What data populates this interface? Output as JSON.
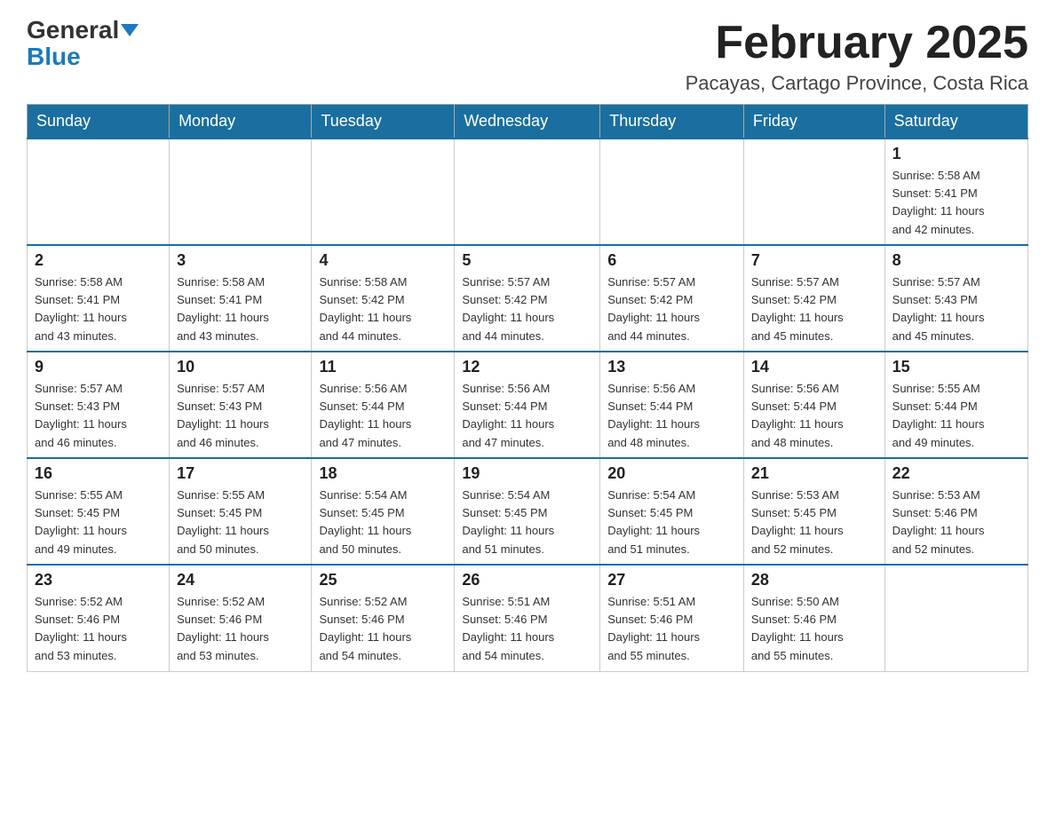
{
  "header": {
    "logo_line1": "General",
    "logo_line2": "Blue",
    "month_title": "February 2025",
    "location": "Pacayas, Cartago Province, Costa Rica"
  },
  "weekdays": [
    "Sunday",
    "Monday",
    "Tuesday",
    "Wednesday",
    "Thursday",
    "Friday",
    "Saturday"
  ],
  "weeks": [
    [
      {
        "day": "",
        "info": ""
      },
      {
        "day": "",
        "info": ""
      },
      {
        "day": "",
        "info": ""
      },
      {
        "day": "",
        "info": ""
      },
      {
        "day": "",
        "info": ""
      },
      {
        "day": "",
        "info": ""
      },
      {
        "day": "1",
        "info": "Sunrise: 5:58 AM\nSunset: 5:41 PM\nDaylight: 11 hours\nand 42 minutes."
      }
    ],
    [
      {
        "day": "2",
        "info": "Sunrise: 5:58 AM\nSunset: 5:41 PM\nDaylight: 11 hours\nand 43 minutes."
      },
      {
        "day": "3",
        "info": "Sunrise: 5:58 AM\nSunset: 5:41 PM\nDaylight: 11 hours\nand 43 minutes."
      },
      {
        "day": "4",
        "info": "Sunrise: 5:58 AM\nSunset: 5:42 PM\nDaylight: 11 hours\nand 44 minutes."
      },
      {
        "day": "5",
        "info": "Sunrise: 5:57 AM\nSunset: 5:42 PM\nDaylight: 11 hours\nand 44 minutes."
      },
      {
        "day": "6",
        "info": "Sunrise: 5:57 AM\nSunset: 5:42 PM\nDaylight: 11 hours\nand 44 minutes."
      },
      {
        "day": "7",
        "info": "Sunrise: 5:57 AM\nSunset: 5:42 PM\nDaylight: 11 hours\nand 45 minutes."
      },
      {
        "day": "8",
        "info": "Sunrise: 5:57 AM\nSunset: 5:43 PM\nDaylight: 11 hours\nand 45 minutes."
      }
    ],
    [
      {
        "day": "9",
        "info": "Sunrise: 5:57 AM\nSunset: 5:43 PM\nDaylight: 11 hours\nand 46 minutes."
      },
      {
        "day": "10",
        "info": "Sunrise: 5:57 AM\nSunset: 5:43 PM\nDaylight: 11 hours\nand 46 minutes."
      },
      {
        "day": "11",
        "info": "Sunrise: 5:56 AM\nSunset: 5:44 PM\nDaylight: 11 hours\nand 47 minutes."
      },
      {
        "day": "12",
        "info": "Sunrise: 5:56 AM\nSunset: 5:44 PM\nDaylight: 11 hours\nand 47 minutes."
      },
      {
        "day": "13",
        "info": "Sunrise: 5:56 AM\nSunset: 5:44 PM\nDaylight: 11 hours\nand 48 minutes."
      },
      {
        "day": "14",
        "info": "Sunrise: 5:56 AM\nSunset: 5:44 PM\nDaylight: 11 hours\nand 48 minutes."
      },
      {
        "day": "15",
        "info": "Sunrise: 5:55 AM\nSunset: 5:44 PM\nDaylight: 11 hours\nand 49 minutes."
      }
    ],
    [
      {
        "day": "16",
        "info": "Sunrise: 5:55 AM\nSunset: 5:45 PM\nDaylight: 11 hours\nand 49 minutes."
      },
      {
        "day": "17",
        "info": "Sunrise: 5:55 AM\nSunset: 5:45 PM\nDaylight: 11 hours\nand 50 minutes."
      },
      {
        "day": "18",
        "info": "Sunrise: 5:54 AM\nSunset: 5:45 PM\nDaylight: 11 hours\nand 50 minutes."
      },
      {
        "day": "19",
        "info": "Sunrise: 5:54 AM\nSunset: 5:45 PM\nDaylight: 11 hours\nand 51 minutes."
      },
      {
        "day": "20",
        "info": "Sunrise: 5:54 AM\nSunset: 5:45 PM\nDaylight: 11 hours\nand 51 minutes."
      },
      {
        "day": "21",
        "info": "Sunrise: 5:53 AM\nSunset: 5:45 PM\nDaylight: 11 hours\nand 52 minutes."
      },
      {
        "day": "22",
        "info": "Sunrise: 5:53 AM\nSunset: 5:46 PM\nDaylight: 11 hours\nand 52 minutes."
      }
    ],
    [
      {
        "day": "23",
        "info": "Sunrise: 5:52 AM\nSunset: 5:46 PM\nDaylight: 11 hours\nand 53 minutes."
      },
      {
        "day": "24",
        "info": "Sunrise: 5:52 AM\nSunset: 5:46 PM\nDaylight: 11 hours\nand 53 minutes."
      },
      {
        "day": "25",
        "info": "Sunrise: 5:52 AM\nSunset: 5:46 PM\nDaylight: 11 hours\nand 54 minutes."
      },
      {
        "day": "26",
        "info": "Sunrise: 5:51 AM\nSunset: 5:46 PM\nDaylight: 11 hours\nand 54 minutes."
      },
      {
        "day": "27",
        "info": "Sunrise: 5:51 AM\nSunset: 5:46 PM\nDaylight: 11 hours\nand 55 minutes."
      },
      {
        "day": "28",
        "info": "Sunrise: 5:50 AM\nSunset: 5:46 PM\nDaylight: 11 hours\nand 55 minutes."
      },
      {
        "day": "",
        "info": ""
      }
    ]
  ]
}
